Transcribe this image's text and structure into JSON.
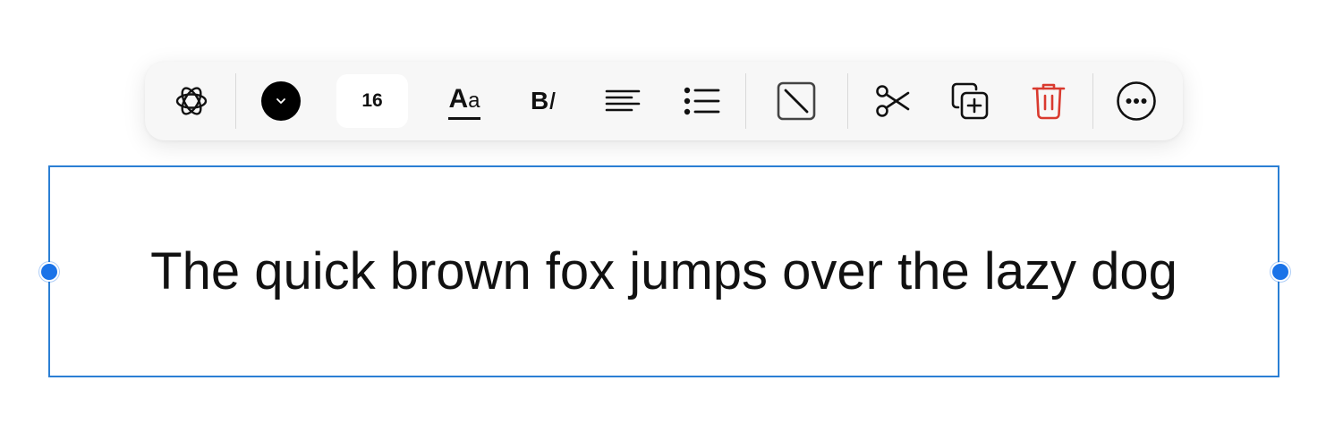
{
  "toolbar": {
    "ai_icon": "sparkle-icon",
    "color": {
      "value": "#000000",
      "icon": "chevron-down-icon"
    },
    "font_size": "16",
    "text_style_icon": {
      "big": "A",
      "small": "a"
    },
    "bold_italic_icon": {
      "bold": "B",
      "italic": "I"
    },
    "align_icon": "align-left-icon",
    "list_icon": "bullet-list-icon",
    "border_icon": "no-border-icon",
    "cut_icon": "scissors-icon",
    "duplicate_icon": "duplicate-icon",
    "delete_icon": "trash-icon",
    "more_icon": "more-icon",
    "accent_delete": "#d93a2f"
  },
  "textbox": {
    "content": "The quick brown fox jumps over the lazy dog",
    "border_color": "#2b7fd4"
  }
}
